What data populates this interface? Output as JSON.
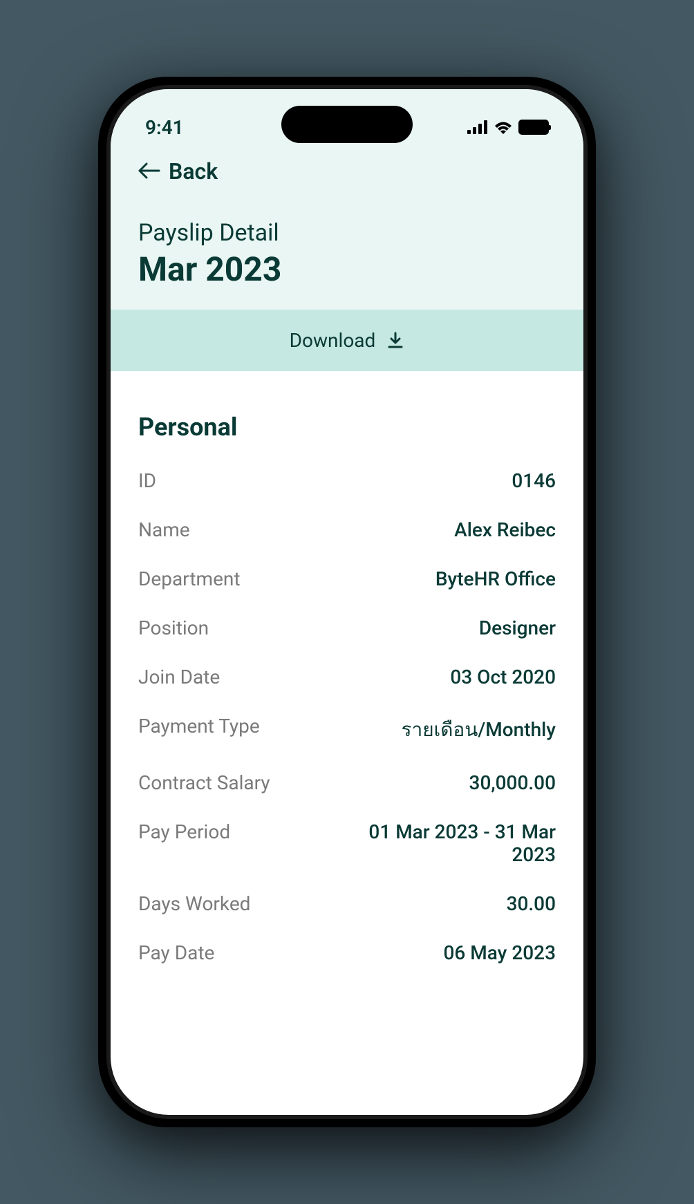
{
  "statusBar": {
    "time": "9:41"
  },
  "nav": {
    "backLabel": "Back"
  },
  "header": {
    "subtitle": "Payslip Detail",
    "title": "Mar 2023"
  },
  "downloadButton": {
    "label": "Download"
  },
  "personal": {
    "sectionTitle": "Personal",
    "rows": [
      {
        "label": "ID",
        "value": "0146"
      },
      {
        "label": "Name",
        "value": "Alex Reibec"
      },
      {
        "label": "Department",
        "value": "ByteHR Office"
      },
      {
        "label": "Position",
        "value": "Designer"
      },
      {
        "label": "Join Date",
        "value": "03 Oct 2020"
      },
      {
        "label": "Payment Type",
        "value": "รายเดือน/Monthly"
      },
      {
        "label": "Contract Salary",
        "value": "30,000.00"
      },
      {
        "label": "Pay Period",
        "value": "01 Mar 2023 - 31 Mar 2023"
      },
      {
        "label": "Days Worked",
        "value": "30.00"
      },
      {
        "label": "Pay Date",
        "value": "06 May 2023"
      }
    ]
  }
}
